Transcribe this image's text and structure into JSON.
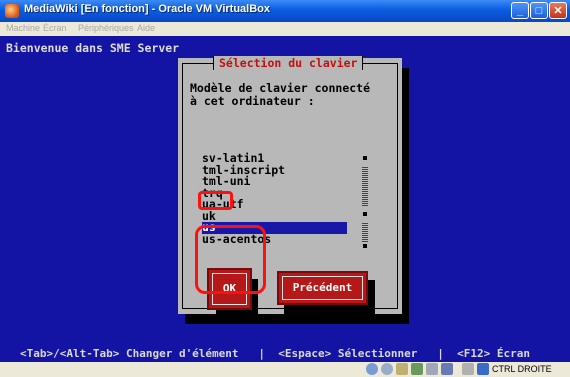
{
  "window": {
    "title": "MediaWiki [En fonction] - Oracle VM VirtualBox"
  },
  "menu": [
    "Machine",
    "Écran",
    "Périphériques",
    "Aide"
  ],
  "screen": {
    "top_text": "Bienvenue dans SME Server",
    "dialog": {
      "title": "Sélection du clavier",
      "prompt_line1": "Modèle de clavier connecté",
      "prompt_line2": "à cet ordinateur :",
      "items": [
        "sv-latin1",
        "tml-inscript",
        "tml-uni",
        "trq",
        "ua-utf",
        "uk",
        "us",
        "us-acentos"
      ],
      "selected": "us",
      "ok_label": "OK",
      "back_label": "Précédent"
    },
    "bottom_help": "<Tab>/<Alt-Tab> Changer d'élément   |  <Espace> Sélectionner   |  <F12> Écran"
  },
  "statusbar": {
    "host_key": "CTRL DROITE"
  },
  "colors": {
    "vm_background": "#1414a4",
    "dialog": "#b8b8b8",
    "accent_red": "#b41818",
    "annotation": "#ff1010"
  }
}
